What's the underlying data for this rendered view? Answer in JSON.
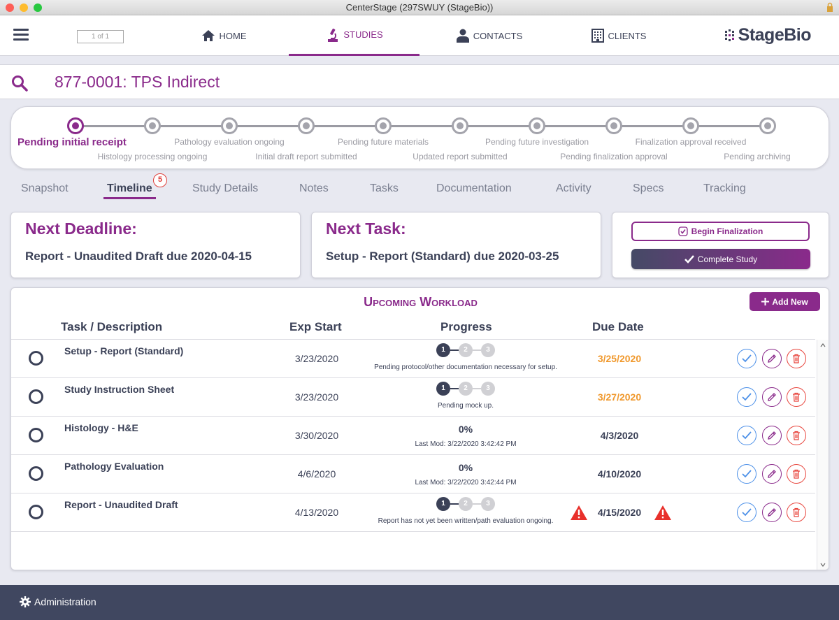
{
  "window": {
    "title": "CenterStage (297SWUY (StageBio))",
    "colors": {
      "close": "#fe5f57",
      "minimize": "#febc2e",
      "zoom": "#28c840"
    }
  },
  "navbar": {
    "page_indicator": "1 of 1",
    "items": [
      {
        "label": "HOME",
        "icon": "home-icon"
      },
      {
        "label": "STUDIES",
        "icon": "microscope-icon",
        "active": true
      },
      {
        "label": "CONTACTS",
        "icon": "person-icon"
      },
      {
        "label": "CLIENTS",
        "icon": "building-icon"
      }
    ],
    "brand": "StageBio"
  },
  "search": {
    "study_title": "877-0001: TPS Indirect"
  },
  "stages": [
    {
      "label": "Pending initial receipt",
      "active": true
    },
    {
      "label": "Histology processing ongoing"
    },
    {
      "label": "Pathology evaluation ongoing"
    },
    {
      "label": "Initial draft report submitted"
    },
    {
      "label": "Pending future materials"
    },
    {
      "label": "Updated report submitted"
    },
    {
      "label": "Pending future investigation"
    },
    {
      "label": "Pending finalization approval"
    },
    {
      "label": "Finalization approval received"
    },
    {
      "label": "Pending archiving"
    }
  ],
  "tabs": [
    {
      "label": "Snapshot"
    },
    {
      "label": "Timeline",
      "active": true,
      "badge": "5"
    },
    {
      "label": "Study Details"
    },
    {
      "label": "Notes"
    },
    {
      "label": "Tasks"
    },
    {
      "label": "Documentation"
    },
    {
      "label": "Activity"
    },
    {
      "label": "Specs"
    },
    {
      "label": "Tracking"
    }
  ],
  "cards": {
    "deadline": {
      "heading": "Next Deadline:",
      "body": "Report - Unaudited Draft due 2020-04-15"
    },
    "task": {
      "heading": "Next Task:",
      "body": "Setup - Report (Standard) due 2020-03-25"
    },
    "actions": {
      "begin_finalization": "Begin Finalization",
      "complete_study": "Complete Study"
    }
  },
  "workload": {
    "title": "Upcoming Workload",
    "add_new": "Add New",
    "columns": [
      "Task / Description",
      "Exp Start",
      "Progress",
      "Due Date"
    ],
    "rows": [
      {
        "task": "Setup - Report (Standard)",
        "exp_start": "3/23/2020",
        "progress_type": "steps",
        "steps_completed": 1,
        "steps": [
          "1",
          "2",
          "3"
        ],
        "note": "Pending protocol/other documentation necessary for setup.",
        "due": "3/25/2020",
        "due_color": "#f0982c",
        "warning": false
      },
      {
        "task": "Study Instruction Sheet",
        "exp_start": "3/23/2020",
        "progress_type": "steps",
        "steps_completed": 1,
        "steps": [
          "1",
          "2",
          "3"
        ],
        "note": "Pending mock up.",
        "due": "3/27/2020",
        "due_color": "#f0982c",
        "warning": false
      },
      {
        "task": "Histology - H&E",
        "exp_start": "3/30/2020",
        "progress_type": "percent",
        "percent": "0%",
        "note": "Last Mod: 3/22/2020 3:42:42 PM",
        "due": "4/3/2020",
        "warning": false
      },
      {
        "task": "Pathology Evaluation",
        "exp_start": "4/6/2020",
        "progress_type": "percent",
        "percent": "0%",
        "note": "Last Mod: 3/22/2020 3:42:44 PM",
        "due": "4/10/2020",
        "warning": false
      },
      {
        "task": "Report - Unaudited Draft",
        "exp_start": "4/13/2020",
        "progress_type": "steps",
        "steps_completed": 1,
        "steps": [
          "1",
          "2",
          "3"
        ],
        "note": "Report has not yet been written/path evaluation ongoing.",
        "due": "4/15/2020",
        "warning": true
      }
    ]
  },
  "footer": {
    "admin_label": "Administration"
  }
}
